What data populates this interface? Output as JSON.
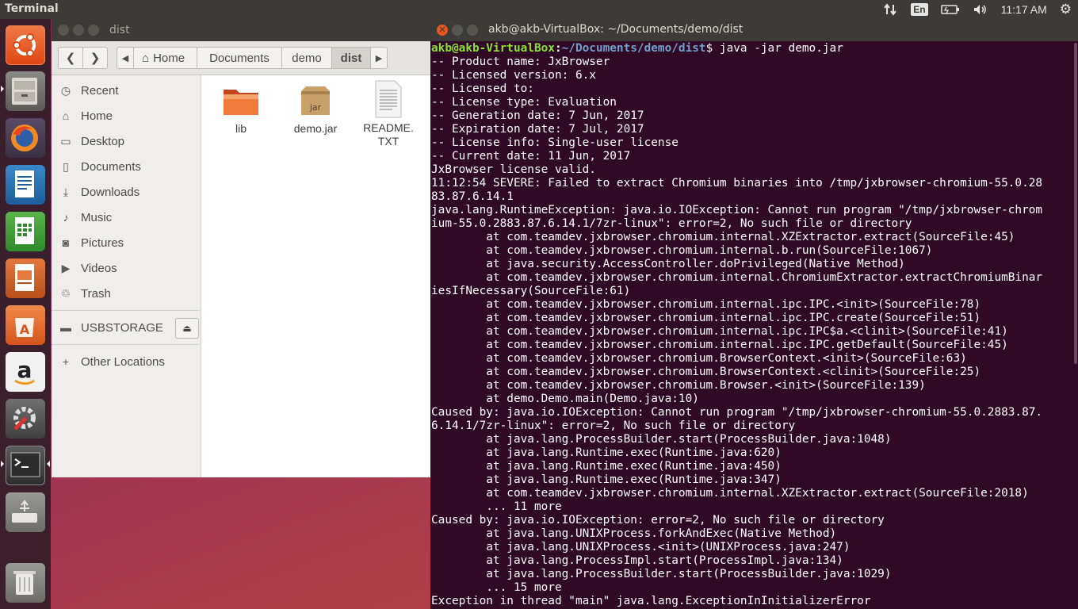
{
  "top_panel": {
    "app_title": "Terminal",
    "keyboard_layout": "En",
    "clock": "11:17 AM"
  },
  "launcher": {
    "items": [
      {
        "name": "ubuntu-dash-icon"
      },
      {
        "name": "files-icon"
      },
      {
        "name": "firefox-icon"
      },
      {
        "name": "libreoffice-writer-icon"
      },
      {
        "name": "libreoffice-calc-icon"
      },
      {
        "name": "libreoffice-impress-icon"
      },
      {
        "name": "software-center-icon"
      },
      {
        "name": "amazon-icon"
      },
      {
        "name": "system-settings-icon"
      },
      {
        "name": "terminal-icon"
      },
      {
        "name": "usb-drive-icon"
      },
      {
        "name": "trash-icon"
      }
    ]
  },
  "files_window": {
    "title": "dist",
    "breadcrumbs": [
      "Home",
      "Documents",
      "demo",
      "dist"
    ],
    "sidebar": {
      "places": [
        {
          "label": "Recent",
          "icon": "clock-icon"
        },
        {
          "label": "Home",
          "icon": "home-icon"
        },
        {
          "label": "Desktop",
          "icon": "folder-icon"
        },
        {
          "label": "Documents",
          "icon": "document-icon"
        },
        {
          "label": "Downloads",
          "icon": "download-icon"
        },
        {
          "label": "Music",
          "icon": "music-icon"
        },
        {
          "label": "Pictures",
          "icon": "camera-icon"
        },
        {
          "label": "Videos",
          "icon": "video-icon"
        },
        {
          "label": "Trash",
          "icon": "trash-icon"
        }
      ],
      "device": "USBSTORAGE",
      "other": "Other Locations"
    },
    "files": [
      {
        "name": "lib",
        "icon": "folder-icon"
      },
      {
        "name": "demo.jar",
        "icon": "jar-icon",
        "badge": "jar"
      },
      {
        "name_line1": "README.",
        "name_line2": "TXT",
        "icon": "text-file-icon"
      }
    ]
  },
  "terminal": {
    "title": "akb@akb-VirtualBox: ~/Documents/demo/dist",
    "prompt_user": "akb@akb-VirtualBox",
    "prompt_path": "~/Documents/demo/dist",
    "command": "$ java -jar demo.jar",
    "lines": [
      "-- Product name: JxBrowser",
      "-- Licensed version: 6.x",
      "-- Licensed to:",
      "-- License type: Evaluation",
      "-- Generation date: 7 Jun, 2017",
      "-- Expiration date: 7 Jul, 2017",
      "-- License info: Single-user license",
      "-- Current date: 11 Jun, 2017",
      "JxBrowser license valid.",
      "11:12:54 SEVERE: Failed to extract Chromium binaries into /tmp/jxbrowser-chromium-55.0.28",
      "83.87.6.14.1",
      "java.lang.RuntimeException: java.io.IOException: Cannot run program \"/tmp/jxbrowser-chrom",
      "ium-55.0.2883.87.6.14.1/7zr-linux\": error=2, No such file or directory",
      "        at com.teamdev.jxbrowser.chromium.internal.XZExtractor.extract(SourceFile:45)",
      "        at com.teamdev.jxbrowser.chromium.internal.b.run(SourceFile:1067)",
      "        at java.security.AccessController.doPrivileged(Native Method)",
      "        at com.teamdev.jxbrowser.chromium.internal.ChromiumExtractor.extractChromiumBinar",
      "iesIfNecessary(SourceFile:61)",
      "        at com.teamdev.jxbrowser.chromium.internal.ipc.IPC.<init>(SourceFile:78)",
      "        at com.teamdev.jxbrowser.chromium.internal.ipc.IPC.create(SourceFile:51)",
      "        at com.teamdev.jxbrowser.chromium.internal.ipc.IPC$a.<clinit>(SourceFile:41)",
      "        at com.teamdev.jxbrowser.chromium.internal.ipc.IPC.getDefault(SourceFile:45)",
      "        at com.teamdev.jxbrowser.chromium.BrowserContext.<init>(SourceFile:63)",
      "        at com.teamdev.jxbrowser.chromium.BrowserContext.<clinit>(SourceFile:25)",
      "        at com.teamdev.jxbrowser.chromium.Browser.<init>(SourceFile:139)",
      "        at demo.Demo.main(Demo.java:10)",
      "Caused by: java.io.IOException: Cannot run program \"/tmp/jxbrowser-chromium-55.0.2883.87.",
      "6.14.1/7zr-linux\": error=2, No such file or directory",
      "        at java.lang.ProcessBuilder.start(ProcessBuilder.java:1048)",
      "        at java.lang.Runtime.exec(Runtime.java:620)",
      "        at java.lang.Runtime.exec(Runtime.java:450)",
      "        at java.lang.Runtime.exec(Runtime.java:347)",
      "        at com.teamdev.jxbrowser.chromium.internal.XZExtractor.extract(SourceFile:2018)",
      "        ... 11 more",
      "Caused by: java.io.IOException: error=2, No such file or directory",
      "        at java.lang.UNIXProcess.forkAndExec(Native Method)",
      "        at java.lang.UNIXProcess.<init>(UNIXProcess.java:247)",
      "        at java.lang.ProcessImpl.start(ProcessImpl.java:134)",
      "        at java.lang.ProcessBuilder.start(ProcessBuilder.java:1029)",
      "        ... 15 more",
      "Exception in thread \"main\" java.lang.ExceptionInInitializerError"
    ]
  }
}
